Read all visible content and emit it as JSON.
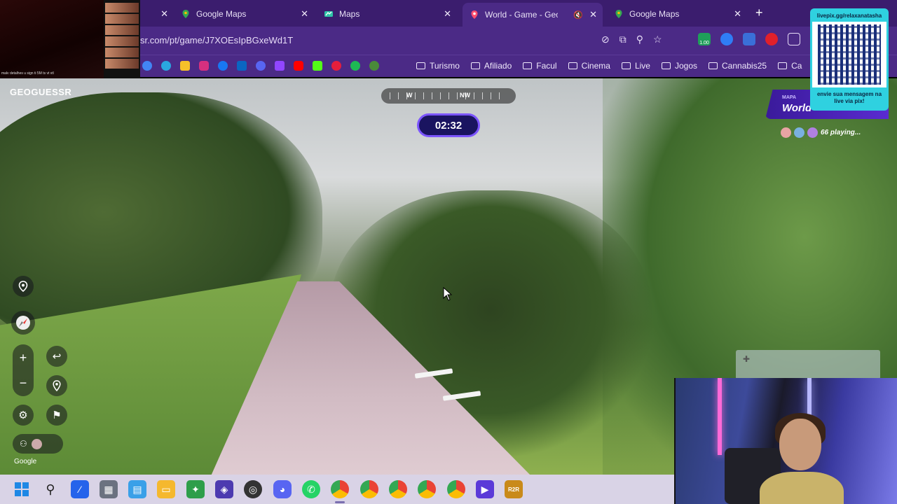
{
  "browser": {
    "tabs": [
      {
        "label": "",
        "close": "✕",
        "favicon": ""
      },
      {
        "label": "Google Maps",
        "close": "✕",
        "favicon": "google-maps-icon"
      },
      {
        "label": "Maps",
        "close": "✕",
        "favicon": "maps-icon"
      },
      {
        "label": "World - Game - GeoGu",
        "close": "✕",
        "favicon": "geoguessr-icon",
        "active": true
      },
      {
        "label": "Google Maps",
        "close": "✕",
        "favicon": "google-maps-icon"
      }
    ],
    "new_tab": "+",
    "url": "sr.com/pt/game/J7XOEsIpBGxeWd1T",
    "ext_badge": "1.00",
    "bookmark_folders": [
      "Turismo",
      "Afiliado",
      "Facul",
      "Cinema",
      "Live",
      "Jogos",
      "Cannabis25",
      "Ca"
    ]
  },
  "stream": {
    "cam_caption": "malv detalhes u sign ti 5M ts vt vtl",
    "qr_top": "livepix.gg/relaxanatasha",
    "qr_bottom": "envie sua mensagem na live via pix!"
  },
  "game": {
    "logo": "GEOGUESSR",
    "compass": {
      "west": "W",
      "northwest": "NW"
    },
    "timer": "02:32",
    "map_label": "MAPA",
    "map_name": "World",
    "players": "66 playing...",
    "zoom_in": "+",
    "zoom_out": "−",
    "google_mark": "Google",
    "colors": {
      "timer_border": "#7c55ff",
      "timer_bg": "#1a1460",
      "map_panel": "#5a2bd0"
    }
  },
  "taskbar": {
    "items": [
      "windows-start-icon",
      "search-icon",
      "vscode-icon",
      "calculator-icon",
      "notepad-icon",
      "file-explorer-icon",
      "game-icon",
      "app-icon",
      "obs-icon",
      "discord-icon",
      "whatsapp-icon",
      "chrome-icon",
      "chrome-icon",
      "chrome-icon",
      "chrome-icon",
      "chrome-icon",
      "media-player-icon",
      "r2r-icon"
    ],
    "r2r_label": "R2R"
  }
}
